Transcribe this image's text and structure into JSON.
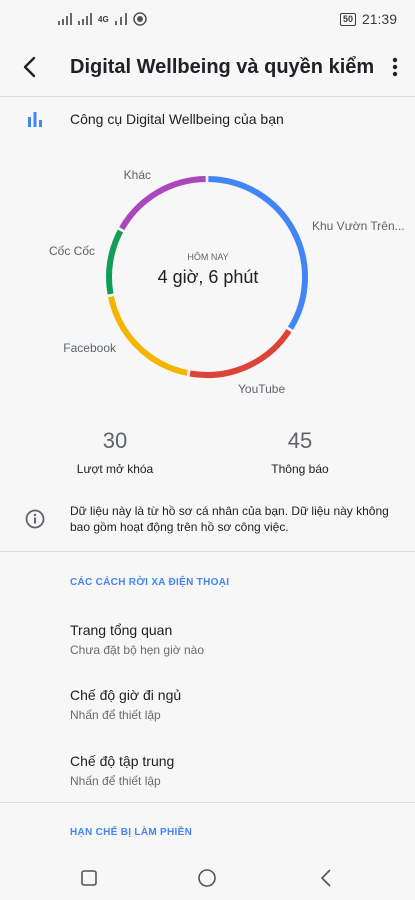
{
  "status_bar": {
    "network": "4G",
    "battery": "50",
    "time": "21:39"
  },
  "app_bar": {
    "title": "Digital Wellbeing và quyền kiểm..."
  },
  "tools": {
    "label": "Công cụ Digital Wellbeing của bạn",
    "icon": "bar-chart-icon"
  },
  "usage": {
    "center_caption": "HÔM NAY",
    "center_value": "4 giờ, 6 phút"
  },
  "chart_data": {
    "type": "pie",
    "categories": [
      "Khu Vườn Trên...",
      "YouTube",
      "Facebook",
      "Cốc Cốc",
      "Khác"
    ],
    "values": [
      34,
      19,
      19,
      11,
      17
    ],
    "colors": [
      "#4285f4",
      "#db4437",
      "#f4b400",
      "#0f9d58",
      "#ab47bc"
    ],
    "title": "",
    "center_label": "4 giờ, 6 phút"
  },
  "stats": {
    "unlocks_value": "30",
    "unlocks_label": "Lượt mở khóa",
    "notifications_value": "45",
    "notifications_label": "Thông báo"
  },
  "info": {
    "text": "Dữ liệu này là từ hồ sơ cá nhân của bạn. Dữ liệu này không bao gồm hoạt động trên hồ sơ công việc."
  },
  "section_disconnect": {
    "header": "CÁC CÁCH RỜI XA ĐIỆN THOẠI",
    "items": [
      {
        "title": "Trang tổng quan",
        "subtitle": "Chưa đặt bộ hẹn giờ nào"
      },
      {
        "title": "Chế độ giờ đi ngủ",
        "subtitle": "Nhấn để thiết lập"
      },
      {
        "title": "Chế độ tập trung",
        "subtitle": "Nhấn để thiết lập"
      }
    ]
  },
  "section_interruptions": {
    "header": "HẠN CHẾ BỊ LÀM PHIỀN"
  }
}
